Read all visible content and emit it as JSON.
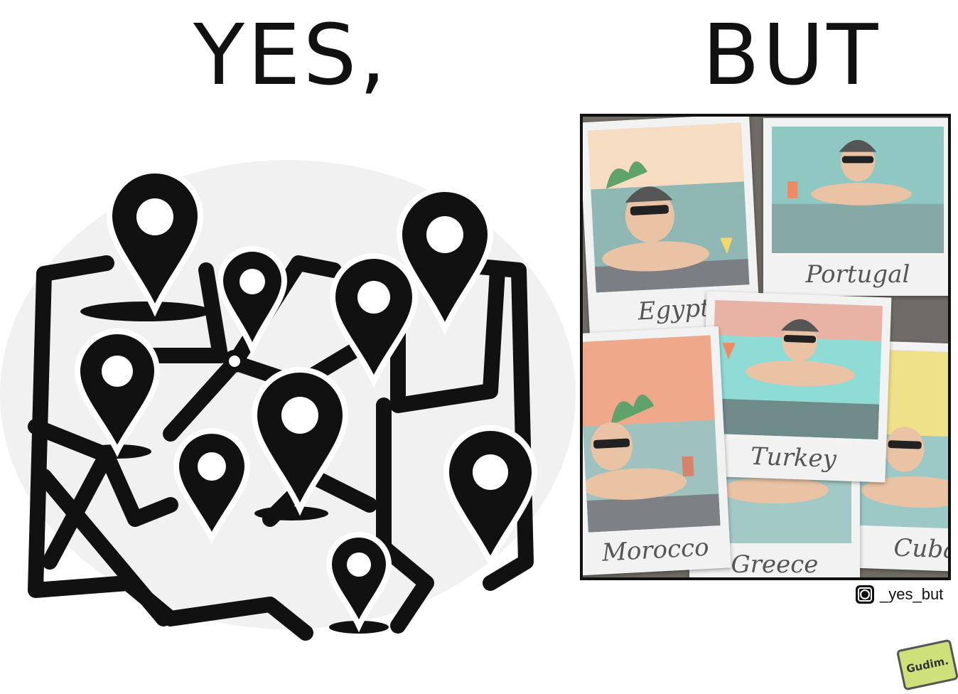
{
  "left_panel": {
    "heading": "YES,"
  },
  "right_panel": {
    "heading": "BUT",
    "photos": [
      {
        "caption": "Egypt",
        "sky": "#f6dcc0",
        "water": "#8fb7b4"
      },
      {
        "caption": "Portugal",
        "sky": "#b7e3e0",
        "water": "#8fc7c3"
      },
      {
        "caption": "Turkey",
        "sky": "#e8b2a4",
        "water": "#8fdbd6"
      },
      {
        "caption": "Morocco",
        "sky": "#efa98a",
        "water": "#9fc2bf"
      },
      {
        "caption": "Greece",
        "sky": "#d9d3c4",
        "water": "#a2c9c6"
      },
      {
        "caption": "Cuba",
        "sky": "#efe08a",
        "water": "#9cc9c6"
      }
    ]
  },
  "credit": {
    "handle": "_yes_but",
    "icon": "instagram-icon",
    "signature": "Gudim."
  },
  "colors": {
    "ink": "#111111",
    "map_bg": "#f1f1f1",
    "skin": "#e9c3a3"
  }
}
